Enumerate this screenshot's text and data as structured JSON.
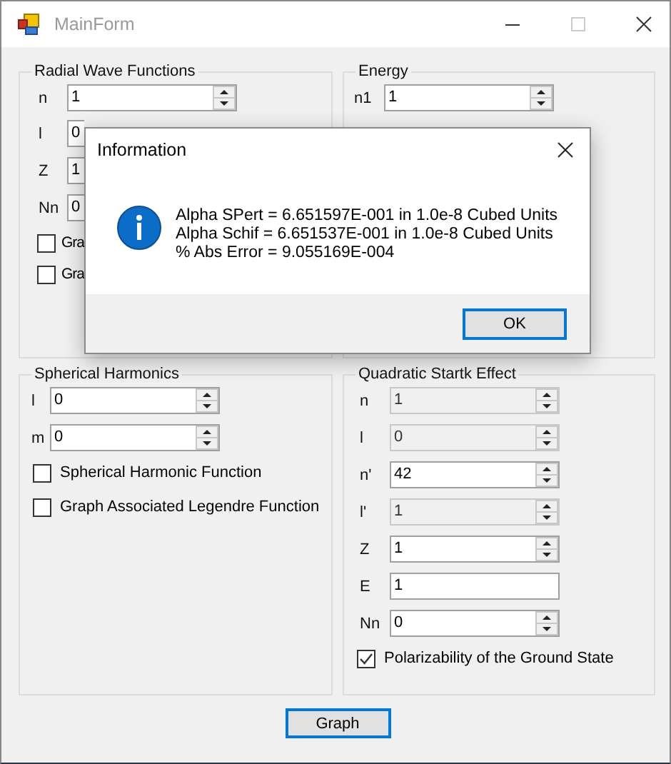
{
  "window": {
    "title": "MainForm"
  },
  "groups": [
    {
      "title": "Radial Wave Functions",
      "fields": [
        {
          "label": "n",
          "value": "1",
          "kind": "spin",
          "disabled": false
        },
        {
          "label": "l",
          "value": "0",
          "kind": "cut",
          "disabled": false
        },
        {
          "label": "Z",
          "value": "1",
          "kind": "cut",
          "disabled": false
        },
        {
          "label": "Nn",
          "value": "0",
          "kind": "cut",
          "disabled": false
        }
      ],
      "checkboxes": [
        {
          "label": "Gra",
          "checked": false
        },
        {
          "label": "Gra",
          "checked": false
        }
      ]
    },
    {
      "title": "Energy",
      "fields": [
        {
          "label": "n1",
          "value": "1",
          "kind": "spin",
          "disabled": false
        }
      ]
    },
    {
      "title": "Spherical Harmonics",
      "fields": [
        {
          "label": "l",
          "value": "0",
          "kind": "spin",
          "disabled": false
        },
        {
          "label": "m",
          "value": "0",
          "kind": "spin",
          "disabled": false
        }
      ],
      "checkboxes": [
        {
          "label": "Spherical Harmonic Function",
          "checked": false
        },
        {
          "label": "Graph Associated Legendre Function",
          "checked": false
        }
      ]
    },
    {
      "title": "Quadratic Startk Effect",
      "fields": [
        {
          "label": "n",
          "value": "1",
          "kind": "spin",
          "disabled": true
        },
        {
          "label": "l",
          "value": "0",
          "kind": "spin",
          "disabled": true
        },
        {
          "label": "n'",
          "value": "42",
          "kind": "spin",
          "disabled": false
        },
        {
          "label": "l'",
          "value": "1",
          "kind": "spin",
          "disabled": true
        },
        {
          "label": "Z",
          "value": "1",
          "kind": "spin",
          "disabled": false
        },
        {
          "label": "E",
          "value": "1",
          "kind": "text",
          "disabled": false
        },
        {
          "label": "Nn",
          "value": "0",
          "kind": "spin",
          "disabled": false
        }
      ],
      "checkboxes": [
        {
          "label": "Polarizability of the Ground State",
          "checked": true
        }
      ]
    }
  ],
  "graph_button": "Graph",
  "dialog": {
    "title": "Information",
    "lines": [
      "Alpha SPert = 6.651597E-001 in 1.0e-8 Cubed Units",
      "Alpha Schif = 6.651537E-001 in 1.0e-8 Cubed Units",
      "% Abs Error = 9.055169E-004"
    ],
    "ok_button": "OK"
  }
}
